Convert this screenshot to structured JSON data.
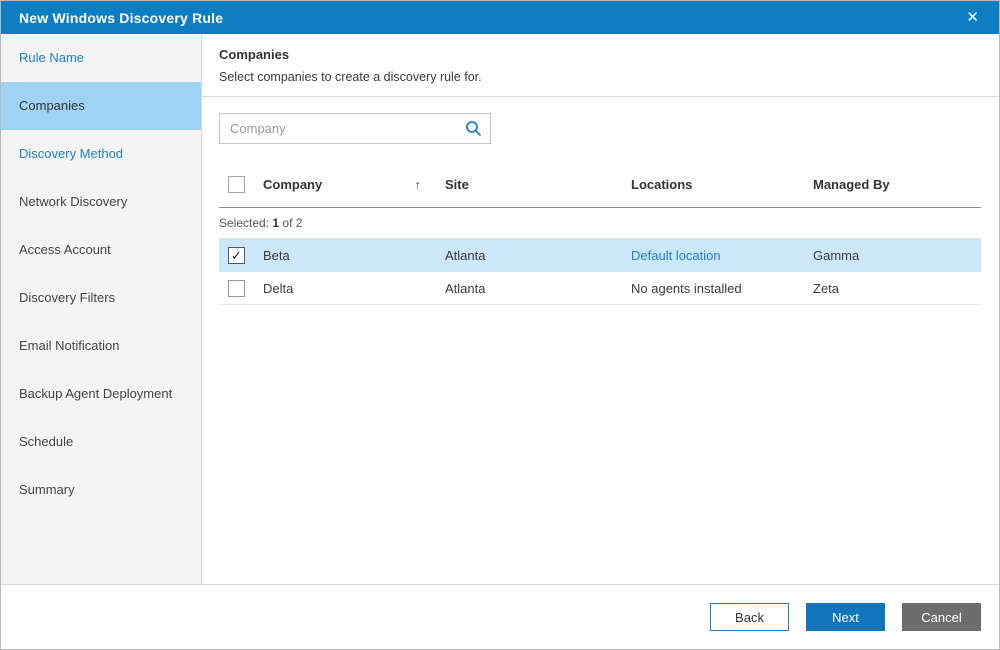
{
  "titlebar": {
    "title": "New Windows Discovery Rule"
  },
  "icons": {
    "close": "✕",
    "check": "✓",
    "sort_ascending": "↑"
  },
  "sidebar": {
    "items": [
      {
        "label": "Rule Name",
        "state": "link"
      },
      {
        "label": "Companies",
        "state": "active"
      },
      {
        "label": "Discovery Method",
        "state": "link"
      },
      {
        "label": "Network Discovery",
        "state": "normal"
      },
      {
        "label": "Access Account",
        "state": "normal"
      },
      {
        "label": "Discovery Filters",
        "state": "normal"
      },
      {
        "label": "Email Notification",
        "state": "normal"
      },
      {
        "label": "Backup Agent Deployment",
        "state": "normal"
      },
      {
        "label": "Schedule",
        "state": "normal"
      },
      {
        "label": "Summary",
        "state": "normal"
      }
    ]
  },
  "content": {
    "heading": "Companies",
    "subheading": "Select companies to create a discovery rule for.",
    "search": {
      "placeholder": "Company"
    },
    "table": {
      "columns": {
        "company": "Company",
        "site": "Site",
        "locations": "Locations",
        "managed_by": "Managed By"
      },
      "sort_column": "Company",
      "sort_direction": "ascending",
      "selected_summary": {
        "prefix": "Selected:",
        "count": "1",
        "suffix": "of 2"
      },
      "rows": [
        {
          "company": "Beta",
          "site": "Atlanta",
          "locations": "Default location",
          "managed_by": "Gamma",
          "checked": true,
          "selected": true,
          "locations_is_link": true
        },
        {
          "company": "Delta",
          "site": "Atlanta",
          "locations": "No agents installed",
          "managed_by": "Zeta",
          "checked": false,
          "selected": false,
          "locations_is_link": false
        }
      ]
    }
  },
  "footer": {
    "back_label": "Back",
    "next_label": "Next",
    "cancel_label": "Cancel"
  },
  "colors": {
    "titlebar_blue": "#0d7ec2",
    "active_step_bg": "#a0d3f2",
    "link_blue": "#1c82c4",
    "selected_row_bg": "#cbe7f9",
    "next_button_bg": "#1274ba",
    "cancel_button_bg": "#6d6d6d"
  }
}
